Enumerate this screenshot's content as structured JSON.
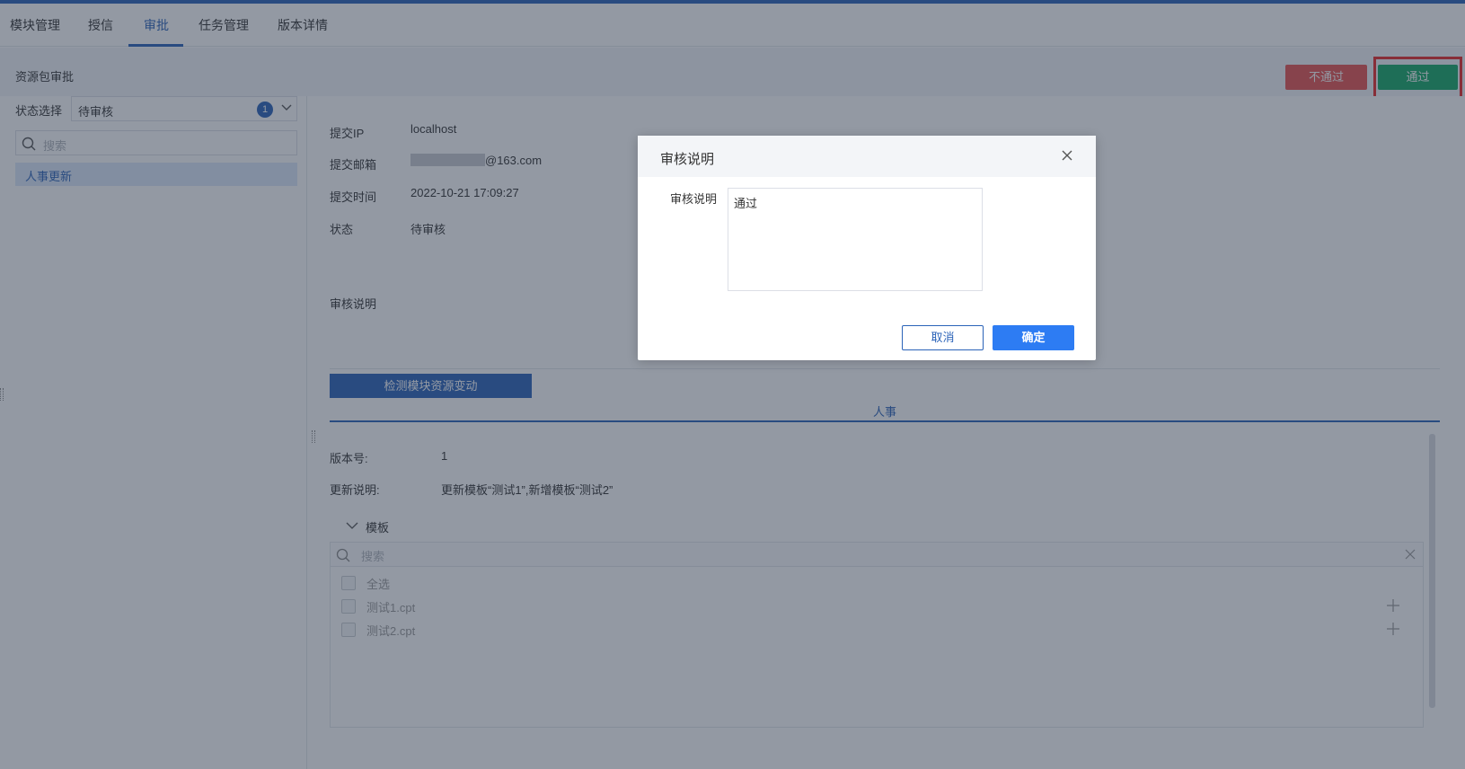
{
  "tabs": [
    {
      "label": "模块管理"
    },
    {
      "label": "授信"
    },
    {
      "label": "审批"
    },
    {
      "label": "任务管理"
    },
    {
      "label": "版本详情"
    }
  ],
  "active_tab": "审批",
  "subbar": {
    "title": "资源包审批",
    "reject_label": "不通过",
    "pass_label": "通过"
  },
  "left": {
    "status_label": "状态选择",
    "status_value": "待审核",
    "status_badge": "1",
    "search_placeholder": "搜索",
    "list_items": [
      {
        "label": "人事更新"
      }
    ]
  },
  "details": {
    "ip_label": "提交IP",
    "ip_value": "localhost",
    "email_label": "提交邮箱",
    "email_value": "@163.com",
    "time_label": "提交时间",
    "time_value": "2022-10-21 17:09:27",
    "state_label": "状态",
    "state_value": "待审核",
    "remark_label": "审核说明"
  },
  "detect_button": "检测模块资源变动",
  "module_tab": "人事",
  "version": {
    "version_label": "版本号:",
    "version_value": "1",
    "update_label": "更新说明:",
    "update_value": "更新模板“测试1”,新增模板“测试2”"
  },
  "templates": {
    "group_label": "模板",
    "search_placeholder": "搜索",
    "select_all": "全选",
    "items": [
      {
        "label": "测试1.cpt"
      },
      {
        "label": "测试2.cpt"
      }
    ]
  },
  "dialog": {
    "title": "审核说明",
    "field_label": "审核说明",
    "textarea_value": "通过",
    "cancel_label": "取消",
    "ok_label": "确定"
  },
  "colors": {
    "primary": "#2b63b8",
    "reject": "#e65251",
    "pass": "#15a867",
    "highlight_box": "#e62828"
  }
}
